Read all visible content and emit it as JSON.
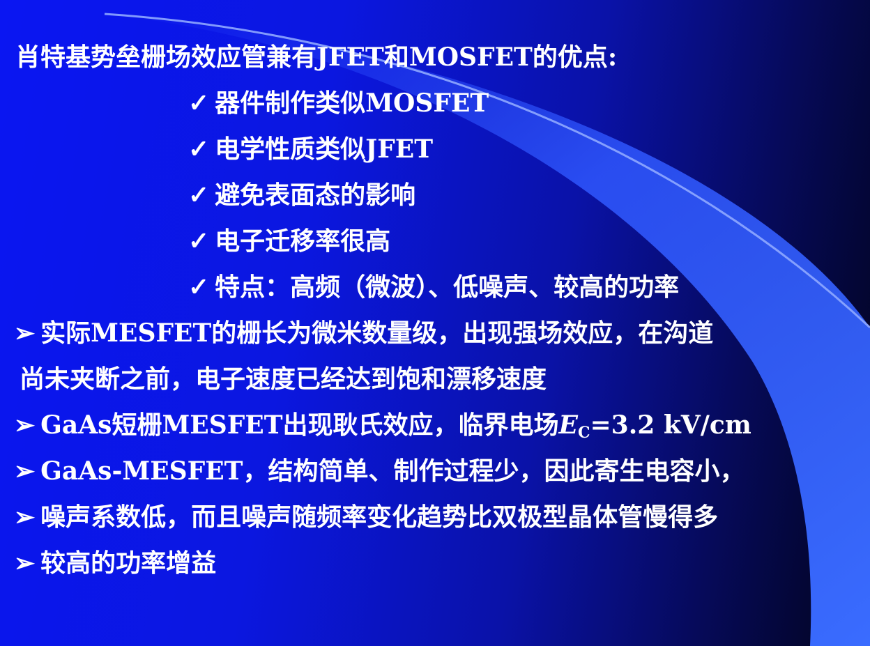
{
  "slide": {
    "title": "肖特基势垒栅场效应管兼有JFET和MOSFET的优点:",
    "check_symbol": "✓",
    "arrow_symbol": "➢",
    "checks": [
      "器件制作类似MOSFET",
      "电学性质类似JFET",
      "避免表面态的影响",
      "电子迁移率很高",
      "特点：高频（微波）、低噪声、较高的功率"
    ],
    "points": {
      "p1_line1": "实际MESFET的栅长为微米数量级，出现强场效应，在沟道",
      "p1_line2": "尚未夹断之前，电子速度已经达到饱和漂移速度",
      "p2_prefix": "GaAs短栅MESFET出现耿氏效应，临界电场",
      "p2_var": "E",
      "p2_sub": "C",
      "p2_suffix": "=3.2 kV/cm",
      "p3": "GaAs-MESFET，结构简单、制作过程少，因此寄生电容小，",
      "p4": "噪声系数低，而且噪声随频率变化趋势比双极型晶体管慢得多",
      "p5": "较高的功率增益"
    }
  }
}
